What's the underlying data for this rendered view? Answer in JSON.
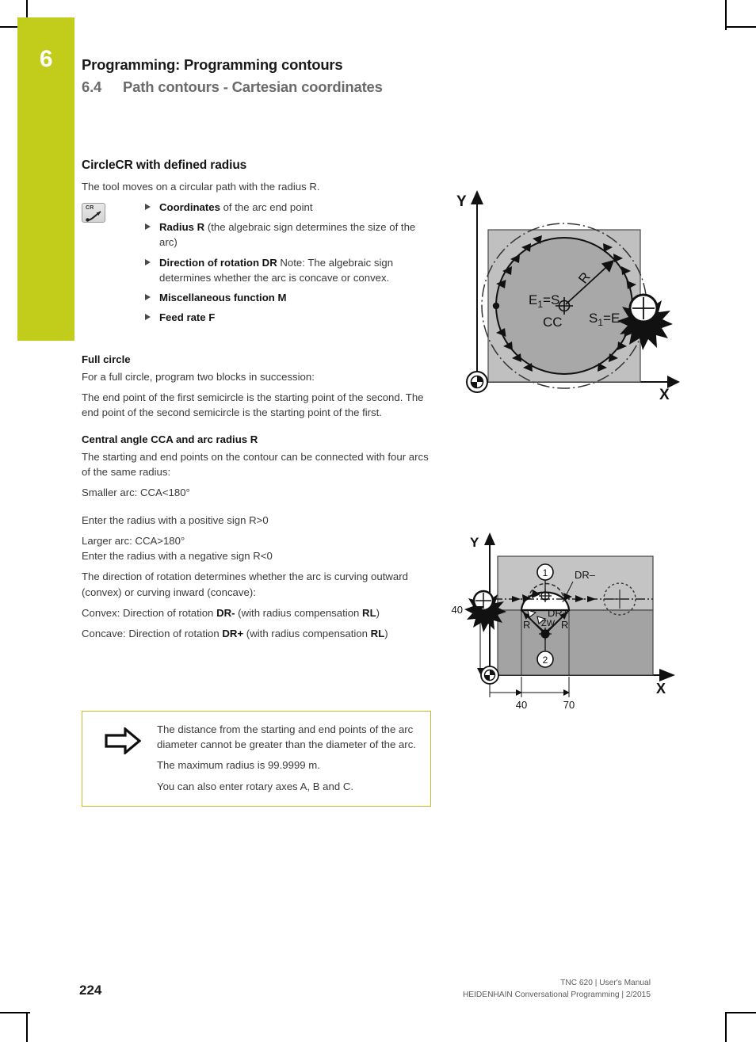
{
  "header": {
    "chapter_number": "6",
    "title": "Programming: Programming contours",
    "section_number": "6.4",
    "section_title": "Path contours - Cartesian coordinates"
  },
  "content": {
    "heading": "CircleCR with defined radius",
    "intro": "The tool moves on a circular path with the radius R.",
    "key_icon_label": "CR",
    "bullets": [
      {
        "bold": "Coordinates",
        "rest": " of the arc end point"
      },
      {
        "bold": "Radius R",
        "rest": " (the algebraic sign determines the size of the arc)"
      },
      {
        "bold": "Direction of rotation DR",
        "rest": " Note: The algebraic sign determines whether the arc is concave or convex."
      },
      {
        "bold": "Miscellaneous function M",
        "rest": ""
      },
      {
        "bold": "Feed rate F",
        "rest": ""
      }
    ],
    "full_circle_heading": "Full circle",
    "full_circle_p1": "For a full circle, program two blocks in succession:",
    "full_circle_p2": "The end point of the first semicircle is the starting point of the second. The end point of the second semicircle is the starting point of the first.",
    "cca_heading": "Central angle CCA and arc radius R",
    "cca_p1": "The starting and end points on the contour can be connected with four arcs of the same radius:",
    "cca_p2": "Smaller arc: CCA<180°",
    "cca_p3": "Enter the radius with a positive sign R>0",
    "cca_p4": "Larger arc: CCA>180°",
    "cca_p5": "Enter the radius with a negative sign R<0",
    "cca_p6": "The direction of rotation determines whether the arc is curving outward (convex) or curving inward (concave):",
    "convex_pre": "Convex: Direction of rotation ",
    "convex_b1": "DR-",
    "convex_mid": " (with radius compensation ",
    "convex_b2": "RL",
    "convex_end": ")",
    "concave_pre": "Concave: Direction of rotation ",
    "concave_b1": "DR+",
    "concave_mid": " (with radius compensation ",
    "concave_b2": "RL",
    "concave_end": ")"
  },
  "note": {
    "icon": "arrow-right-icon",
    "line1": "The distance from the starting and end points of the arc diameter cannot be greater than the diameter of the arc.",
    "line2": "The maximum radius is 99.9999 m.",
    "line3": "You can also enter rotary axes A, B and C."
  },
  "figure1": {
    "axis_y": "Y",
    "axis_x": "X",
    "label_center": "CC",
    "label_radius": "R",
    "label_end": "E",
    "label_end_sub": "1",
    "label_end_eq": "=S",
    "label_start": "S",
    "label_start_sub": "1",
    "label_start_eq": "=E"
  },
  "figure2": {
    "axis_y": "Y",
    "axis_x": "X",
    "dim_y": "40",
    "dim_x1": "40",
    "dim_x2": "70",
    "callout_1": "1",
    "callout_2": "2",
    "label_dr_minus": "DR–",
    "label_dr_plus": "DR+",
    "label_zw": "ZW",
    "label_r_left": "R",
    "label_r_right": "R"
  },
  "footer": {
    "page_number": "224",
    "line1": "TNC 620 | User's Manual",
    "line2": "HEIDENHAIN Conversational Programming | 2/2015"
  },
  "colors": {
    "brand_green": "#c2cc1b",
    "note_border": "#c9bc2a",
    "text_primary": "#141414",
    "text_body": "#3a3a3a",
    "text_muted": "#6b6b6b"
  }
}
